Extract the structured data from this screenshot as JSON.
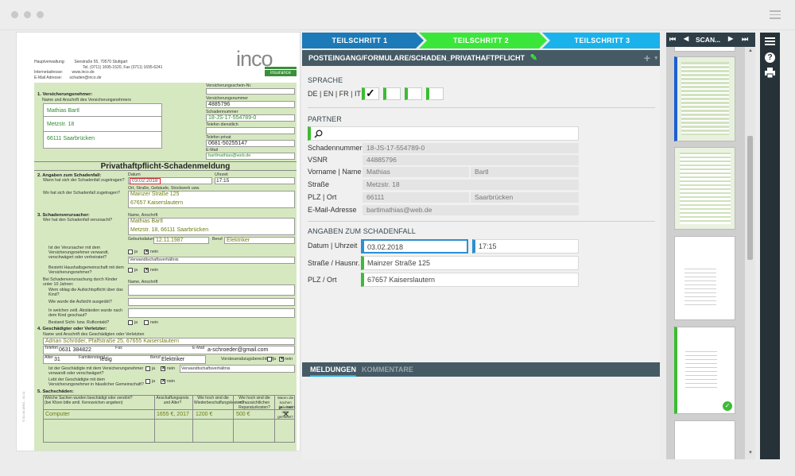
{
  "steps": [
    "TEILSCHRITT 1",
    "TEILSCHRITT 2",
    "TEILSCHRITT 3"
  ],
  "path_title": "POSTEINGANG/FORMULARE/SCHADEN_PRIVATHAFTPFLICHT",
  "sprache": {
    "label": "SPRACHE",
    "langs": "DE | EN | FR | IT",
    "check": "✓"
  },
  "partner": {
    "label": "PARTNER",
    "rows": [
      {
        "label": "Schadennummer",
        "v1": "18-JS-17-554789-0"
      },
      {
        "label": "VSNR",
        "v1": "44885796"
      },
      {
        "label": "Vorname | Name",
        "v1": "Mathias",
        "v2": "Bartl"
      },
      {
        "label": "Straße",
        "v1": "Metzstr. 18"
      },
      {
        "label": "PLZ | Ort",
        "v1": "66111",
        "v2": "Saarbrücken"
      },
      {
        "label": "E-Mail-Adresse",
        "v1": "bartlmathias@web.de"
      }
    ]
  },
  "schaden": {
    "label": "ANGABEN ZUM SCHADENFALL",
    "datum_label": "Datum | Uhrzeit",
    "datum": "03.02.2018",
    "uhrzeit": "17:15",
    "strasse_label": "Straße / Hausnr.",
    "strasse": "Mainzer Straße 125",
    "plz_label": "PLZ / Ort",
    "plz": "67657 Kaiserslautern"
  },
  "tabs": {
    "a": "MELDUNGEN",
    "b": "KOMMENTARE"
  },
  "scan": {
    "title": "SCAN..."
  },
  "icons": {
    "first": "⏮",
    "prev": "◀",
    "next": "▶",
    "last": "⏭",
    "menu": "☰",
    "help": "?",
    "print": "🖶",
    "edit": "✎",
    "plus": "+",
    "check": "✓"
  },
  "doc": {
    "company": "Hauptverwaltung:",
    "company_addr": "Seestraße 55, 70570 Stuttgart",
    "tel": "Tel. (0711) 1695-1520, Fax (0711) 1695-6241",
    "inet_l": "Internetadresse:",
    "inet": "www.inco.de",
    "mail_l": "E-Mail Adresse:",
    "mail": "schaden@inco.de",
    "logo": "inco",
    "logo_sub": "insurance",
    "s1": "1. Versicherungsnehmer:",
    "s1_sub": "Name und Anschrift des Versicherungsnehmers",
    "vn_name": "Mathias Bartl",
    "vn_street": "Metzstr. 18",
    "vn_city": "66111 Saarbrücken",
    "vs_l": "Versicherungsschein-Nr.",
    "vnr_l": "Versicherungsnummer",
    "vnr": "4885796",
    "snr_l": "Schadennummer",
    "snr": "18-JS-17-554789-0",
    "tel_d": "Telefon dienstlich",
    "tel_p": "Telefon privat",
    "tel_pv": "0681-50255147",
    "email_l": "E-Mail",
    "email": "bartlmathias@web.de",
    "title": "Privathaftpflicht-Schadenmeldung",
    "s2": "2. Angaben zum Schadenfall:",
    "s2_q": "Wann hat sich der Schadenfall zugetragen?",
    "datum_l": "Datum",
    "datum": "03.02.2018",
    "uhr_l": "Uhrzeit",
    "uhr": "17:15",
    "ort_l": "Ort, Straße, Gebäude, Stockwerk usw.",
    "s2_q2": "Wo hat sich der Schadenfall zugetragen?",
    "ort1": "Mainzer Straße 125",
    "ort2": "67657 Kaiserslautern",
    "s3": "3. Schadenverursacher:",
    "s3_q": "Wer hat den Schadenfall verursacht?",
    "na_l": "Name, Anschrift",
    "v_name": "Mathias Bartl",
    "v_addr": "Metzstr. 18, 66111 Saarbrücken",
    "geb_l": "Geburtsdatum",
    "geb": "12.11.1987",
    "beruf_l": "Beruf",
    "beruf": "Elektriker",
    "q_verw": "Ist der Verursacher mit dem Versicherungsnehmer verwandt, verschwägert oder verheiratet?",
    "ja": "ja",
    "nein": "nein",
    "verw": "Verwandtschaftsverhältnis",
    "q_haus": "Besteht Haushaltsgemeinschaft mit dem Versicherungsnehmer?",
    "q_kind": "Bei Schadenverursachung durch Kinder unter 10 Jahren:",
    "q_k1": "Wem oblag die Aufsichtspflicht über das Kind?",
    "q_k2": "Wie wurde die Aufsicht ausgeübt?",
    "q_k3": "In welchen zeitl. Abständen wurde nach dem Kind geschaut?",
    "q_k4": "Bestand Sicht- bzw. Rufkontakt?",
    "s4": "4. Geschädigter oder Verletzter:",
    "s4_sub": "Name und Anschrift des Geschädigten oder Verletzten",
    "g_name": "Adrian Schröder, Pfaffstraße 25, 67655 Kaiserslautern",
    "tel_l": "Telefon",
    "g_tel": "0631 384822",
    "fax_l": "Fax",
    "mail_l2": "E-Mail",
    "g_mail": "a-schroeder@gmail.com",
    "alter_l": "Alter",
    "g_alter": "31",
    "fam_l": "Familienstand",
    "g_fam": "ledig",
    "g_beruf": "Elektriker",
    "vorst": "Vorsteuerabzugsberechtigt?",
    "q_g1": "Ist der Geschädigte mit dem Versicherungsnehmer verwandt oder verschwägert?",
    "q_g2": "Lebt der Geschädigte mit dem Versicherungsnehmer in häuslicher Gemeinschaft?",
    "s5": "5. Sachschäden:",
    "c1": "Welche Sachen wurden beschädigt oder zerstört? (bei Kfzen bitte amtl. Kennzeichen angeben)",
    "c2": "Anschaffungspreis und Alter?",
    "c3": "Wie hoch sind die Wiederbeschaffungskosten?",
    "c4": "Wie hoch sind die voraussichtlichen Reparaturkosten?",
    "c5": "Waren die Sachen geliehen oder gemietet?",
    "item": "Computer",
    "price": "1655 €, 2017",
    "wieder": "1200 €",
    "rep": "500 €",
    "x": "✕",
    "side": "© 01.04.18/01 - 01.11"
  }
}
